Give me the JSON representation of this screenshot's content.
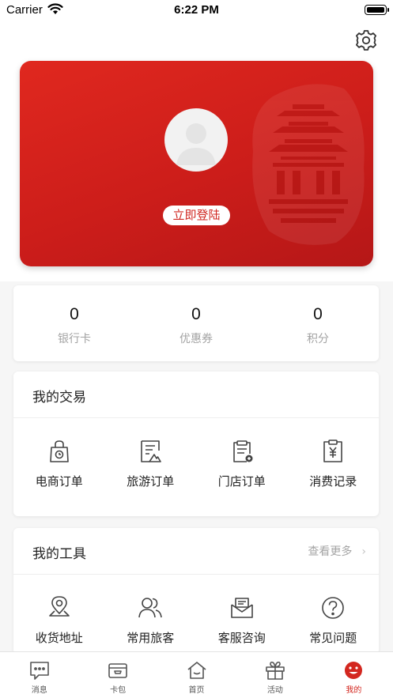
{
  "status_bar": {
    "carrier": "Carrier",
    "time": "6:22 PM"
  },
  "profile": {
    "login_label": "立即登陆",
    "card_color": "#d0261f"
  },
  "stats": [
    {
      "value": "0",
      "label": "银行卡"
    },
    {
      "value": "0",
      "label": "优惠券"
    },
    {
      "value": "0",
      "label": "积分"
    }
  ],
  "trade": {
    "title": "我的交易",
    "items": [
      {
        "label": "电商订单",
        "icon": "shopping-bag-icon"
      },
      {
        "label": "旅游订单",
        "icon": "travel-document-icon"
      },
      {
        "label": "门店订单",
        "icon": "clipboard-order-icon"
      },
      {
        "label": "消费记录",
        "icon": "yuan-receipt-icon"
      }
    ]
  },
  "tools": {
    "title": "我的工具",
    "more_label": "查看更多",
    "items": [
      {
        "label": "收货地址",
        "icon": "location-pin-icon"
      },
      {
        "label": "常用旅客",
        "icon": "users-icon"
      },
      {
        "label": "客服咨询",
        "icon": "mail-icon"
      },
      {
        "label": "常见问题",
        "icon": "question-circle-icon"
      }
    ]
  },
  "tab_bar": {
    "active_color": "#d3271f",
    "tabs": [
      {
        "label": "消息",
        "icon": "chat-bubble-icon",
        "active": false
      },
      {
        "label": "卡包",
        "icon": "wallet-icon",
        "active": false
      },
      {
        "label": "首页",
        "icon": "home-icon",
        "active": false
      },
      {
        "label": "活动",
        "icon": "gift-icon",
        "active": false
      },
      {
        "label": "我的",
        "icon": "smile-face-icon",
        "active": true
      }
    ]
  }
}
